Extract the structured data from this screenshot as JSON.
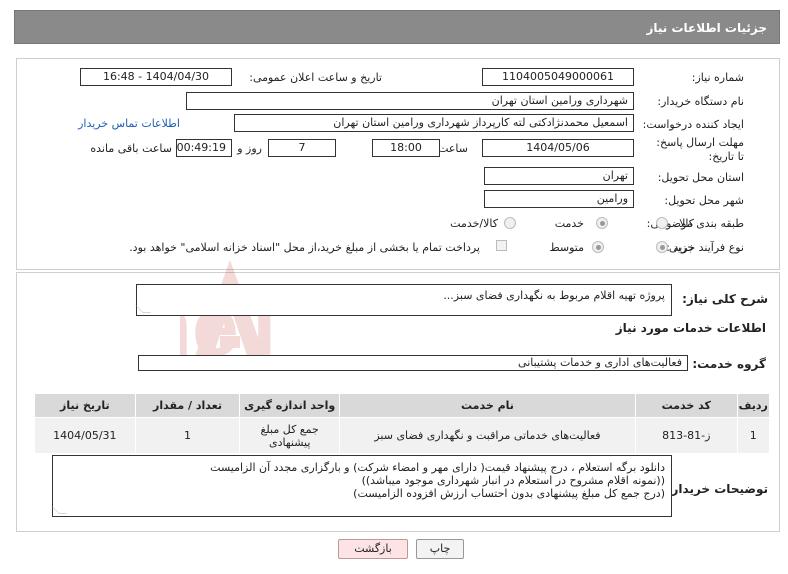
{
  "header": {
    "title": "جزئیات اطلاعات نیاز"
  },
  "fields": {
    "need_number_label": "شماره نیاز:",
    "need_number": "1104005049000061",
    "announce_label": "تاریخ و ساعت اعلان عمومی:",
    "announce_value": "1404/04/30 - 16:48",
    "buyer_org_label": "نام دستگاه خریدار:",
    "buyer_org": "شهرداری ورامین استان تهران",
    "creator_label": "ایجاد کننده درخواست:",
    "creator": "اسمعیل محمدنژادکتی لته کارپرداز شهرداری ورامین استان تهران",
    "contact_link": "اطلاعات تماس خریدار",
    "deadline_label": "مهلت ارسال پاسخ: تا تاریخ:",
    "deadline_date": "1404/05/06",
    "time_label": "ساعت",
    "deadline_time": "18:00",
    "days_value": "7",
    "days_label": "روز و",
    "remaining_value": "00:49:19",
    "remaining_label": "ساعت باقی مانده",
    "province_label": "استان محل تحویل:",
    "province": "تهران",
    "city_label": "شهر محل تحویل:",
    "city": "ورامین",
    "category_label": "طبقه بندی موضوعی:",
    "category_options": [
      "کالا",
      "خدمت",
      "کالا/خدمت"
    ],
    "category_selected": "خدمت",
    "purchase_type_label": "نوع فرآیند خرید :",
    "purchase_options": [
      "جزیی",
      "متوسط"
    ],
    "purchase_selected": "متوسط",
    "payment_note": "پرداخت تمام یا بخشی از مبلغ خرید،از محل \"اسناد خزانه اسلامی\" خواهد بود."
  },
  "summary": {
    "label": "شرح کلی نیاز:",
    "text": "پروژه تهیه اقلام مربوط به نگهداری فضای سبز..."
  },
  "services": {
    "section_title": "اطلاعات خدمات مورد نیاز",
    "group_label": "گروه خدمت:",
    "group_value": "فعالیت‌های اداری و خدمات پشتیبانی",
    "columns": [
      "ردیف",
      "کد خدمت",
      "نام خدمت",
      "واحد اندازه گیری",
      "تعداد / مقدار",
      "تاریخ نیاز"
    ],
    "rows": [
      [
        "1",
        "ز-81-813",
        "فعالیت‌های خدماتی مراقبت و نگهداری فضای سبز",
        "جمع کل مبلغ پیشنهادی",
        "1",
        "1404/05/31"
      ]
    ]
  },
  "buyer_notes": {
    "label": "توضیحات خریدار:",
    "lines": [
      "دانلود برگه استعلام ، درج پیشنهاد قیمت( دارای مهر و امضاء شرکت) و بارگزاری مجدد آن الزامیست",
      "((نمونه اقلام مشروح در استعلام در انبار شهرداری موجود میباشد))",
      "(درج  جمع کل مبلغ پیشنهادی بدون احتساب ارزش افزوده الزامیست)"
    ]
  },
  "buttons": {
    "print": "چاپ",
    "back": "بازگشت"
  },
  "watermark": {
    "text": "AriaTender.neT"
  },
  "colors": {
    "header_bg": "#8a8a8a",
    "link": "#1f5fb3",
    "back_button_bg": "#fde3e3",
    "watermark": "#c0392b"
  }
}
